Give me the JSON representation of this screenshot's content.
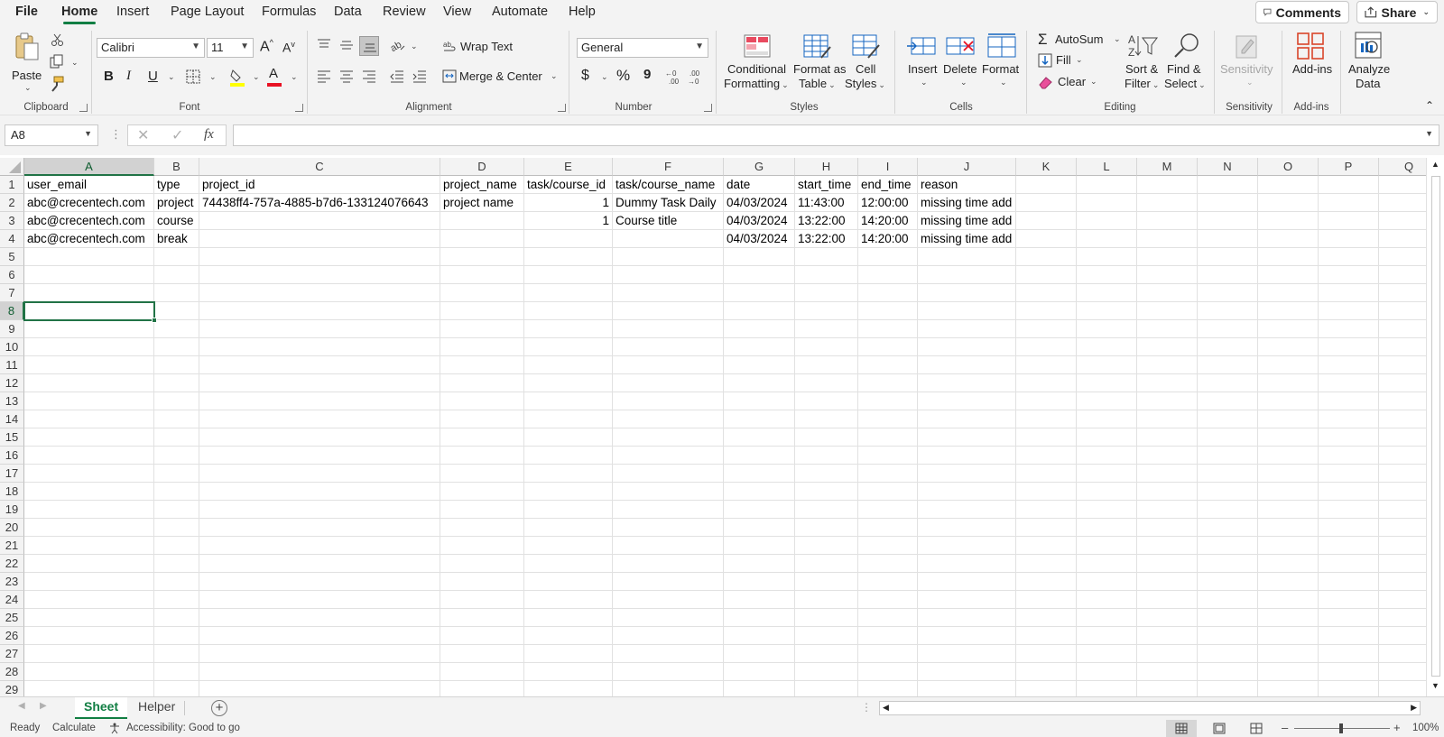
{
  "menu": {
    "tabs": [
      "File",
      "Home",
      "Insert",
      "Page Layout",
      "Formulas",
      "Data",
      "Review",
      "View",
      "Automate",
      "Help"
    ],
    "active": "Home",
    "comments_label": "Comments",
    "share_label": "Share"
  },
  "ribbon": {
    "clipboard": {
      "paste": "Paste",
      "group": "Clipboard"
    },
    "font": {
      "name": "Calibri",
      "size": "11",
      "bold": "B",
      "italic": "I",
      "underline": "U",
      "group": "Font",
      "grow": "A",
      "shrink": "A",
      "font_color_glyph": "A"
    },
    "alignment": {
      "wrap_text": "Wrap Text",
      "merge_center": "Merge & Center",
      "group": "Alignment"
    },
    "number": {
      "format": "General",
      "currency": "$",
      "percent": "%",
      "comma": "9",
      "group": "Number"
    },
    "styles": {
      "conditional": [
        "Conditional",
        "Formatting"
      ],
      "format_table": [
        "Format as",
        "Table"
      ],
      "cell_styles": [
        "Cell",
        "Styles"
      ],
      "group": "Styles"
    },
    "cells": {
      "insert": "Insert",
      "delete": "Delete",
      "format": "Format",
      "group": "Cells"
    },
    "editing": {
      "autosum": "AutoSum",
      "fill": "Fill",
      "clear": "Clear",
      "sort": [
        "Sort &",
        "Filter"
      ],
      "find": [
        "Find &",
        "Select"
      ],
      "group": "Editing"
    },
    "sensitivity": {
      "label": "Sensitivity",
      "group": "Sensitivity"
    },
    "addins": {
      "label": "Add-ins",
      "group": "Add-ins"
    },
    "analyze": {
      "label": [
        "Analyze",
        "Data"
      ]
    }
  },
  "formula_bar": {
    "name_box": "A8",
    "fx": "fx",
    "formula": ""
  },
  "columns": [
    "A",
    "B",
    "C",
    "D",
    "E",
    "F",
    "G",
    "H",
    "I",
    "J",
    "K",
    "L",
    "M",
    "N",
    "O",
    "P",
    "Q"
  ],
  "rows_count": 29,
  "selected_cell": {
    "col": "A",
    "row": 8
  },
  "cells": [
    [
      "user_email",
      "type",
      "project_id",
      "project_name",
      "task/course_id",
      "task/course_name",
      "date",
      "start_time",
      "end_time",
      "reason"
    ],
    [
      "abc@crecentech.com",
      "project",
      "74438ff4-757a-4885-b7d6-133124076643",
      "project name",
      "1",
      "Dummy Task Daily",
      "04/03/2024",
      "11:43:00",
      "12:00:00",
      "missing time add"
    ],
    [
      "abc@crecentech.com",
      "course",
      "",
      "",
      "1",
      "Course title",
      "04/03/2024",
      "13:22:00",
      "14:20:00",
      "missing time add"
    ],
    [
      "abc@crecentech.com",
      "break",
      "",
      "",
      "",
      "",
      "04/03/2024",
      "13:22:00",
      "14:20:00",
      "missing time add"
    ]
  ],
  "sheets": [
    "Sheet",
    "Helper"
  ],
  "active_sheet": "Sheet",
  "status": {
    "ready": "Ready",
    "calculate": "Calculate",
    "accessibility": "Accessibility: Good to go",
    "zoom": "100%"
  },
  "colors": {
    "excel_green": "#217346",
    "tab_green": "#117e43"
  }
}
